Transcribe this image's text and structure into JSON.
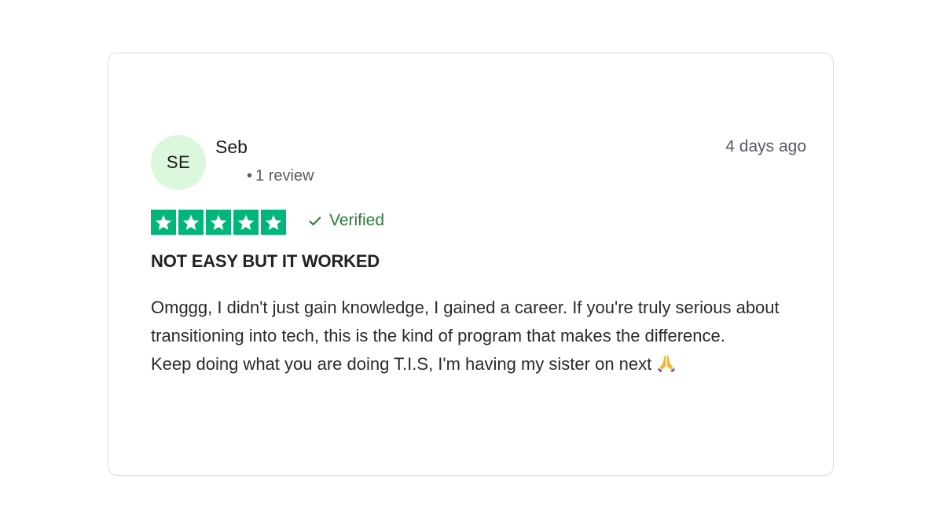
{
  "reviewer": {
    "initials": "SE",
    "name": "Seb",
    "review_count": "1 review",
    "avatar_color": "#dcf8dc"
  },
  "date": "4 days ago",
  "rating": {
    "stars": 5,
    "max": 5,
    "star_color": "#00b67a",
    "icon": "star-icon"
  },
  "verified": {
    "label": "Verified",
    "icon": "checkmark-icon",
    "color": "#2c7a3c"
  },
  "review": {
    "title": "NOT EASY BUT IT WORKED",
    "paragraph_1": "Omggg, I didn't just gain knowledge, I gained a career. If you're truly serious about transitioning into tech, this is the kind of program that makes the difference.",
    "paragraph_2": "Keep doing what you are doing T.I.S, I'm having my sister on next",
    "emoji_icon": "folded-hands-icon"
  }
}
